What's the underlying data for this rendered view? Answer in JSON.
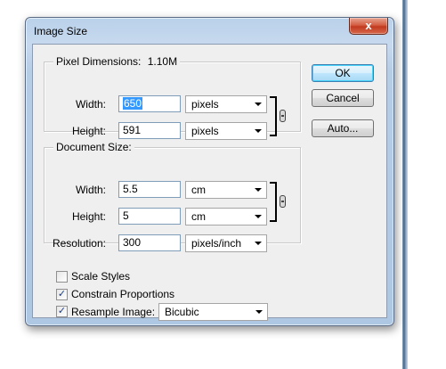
{
  "window": {
    "title": "Image Size",
    "close_glyph": "x"
  },
  "pixel_dimensions": {
    "label": "Pixel Dimensions:",
    "size": "1.10M",
    "width_label": "Width:",
    "width_value": "650",
    "width_unit": "pixels",
    "height_label": "Height:",
    "height_value": "591",
    "height_unit": "pixels"
  },
  "document_size": {
    "label": "Document Size:",
    "width_label": "Width:",
    "width_value": "5.5",
    "width_unit": "cm",
    "height_label": "Height:",
    "height_value": "5",
    "height_unit": "cm",
    "resolution_label": "Resolution:",
    "resolution_value": "300",
    "resolution_unit": "pixels/inch"
  },
  "options": {
    "scale_styles": {
      "label": "Scale Styles",
      "checked": false
    },
    "constrain_proportions": {
      "label": "Constrain Proportions",
      "checked": true
    },
    "resample_image": {
      "label": "Resample Image:",
      "checked": true,
      "method": "Bicubic"
    }
  },
  "buttons": {
    "ok": "OK",
    "cancel": "Cancel",
    "auto": "Auto..."
  }
}
